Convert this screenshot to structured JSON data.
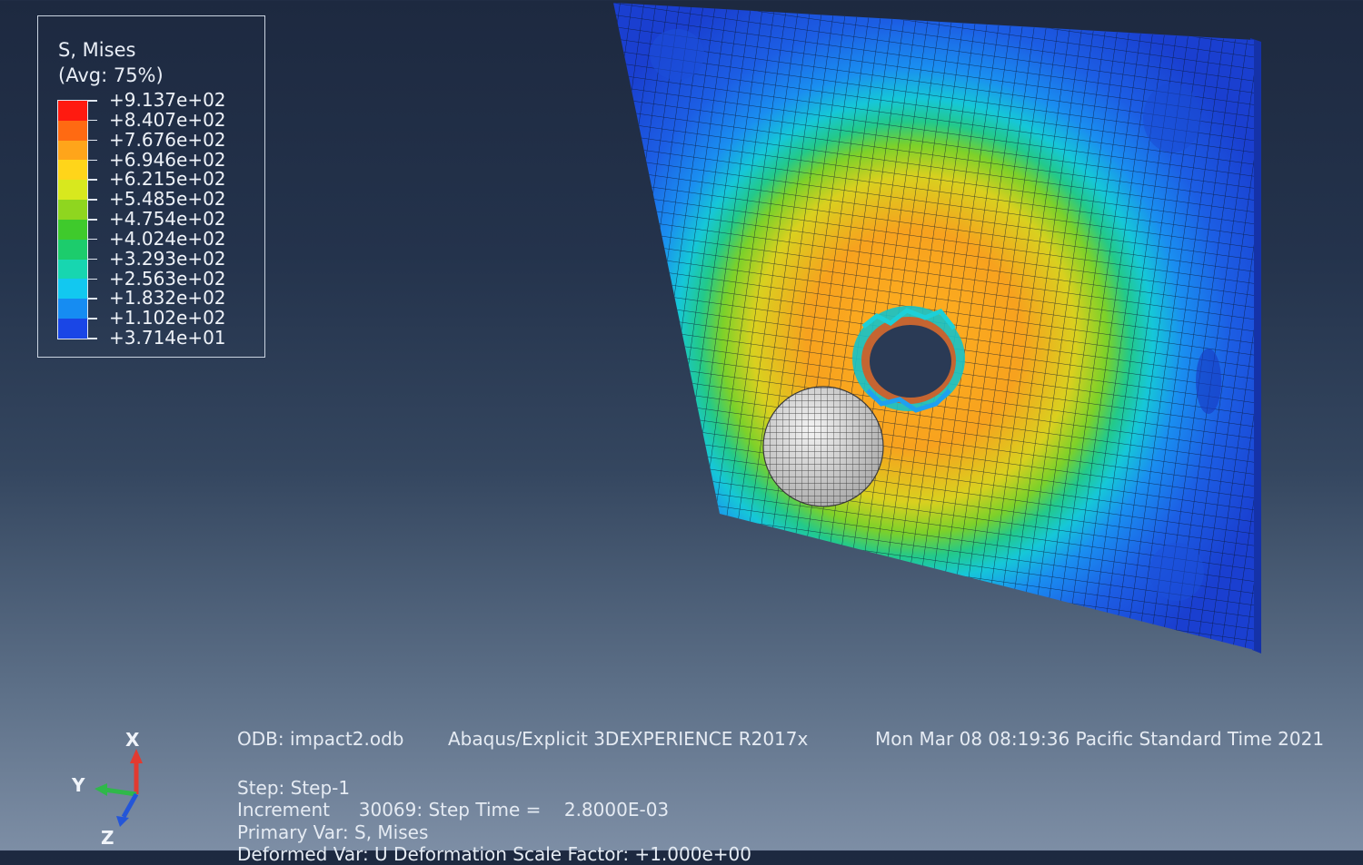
{
  "legend": {
    "title": "S, Mises",
    "subtitle": "(Avg: 75%)",
    "levels": [
      {
        "label": "+9.137e+02",
        "color": "#ff1a10"
      },
      {
        "label": "+8.407e+02",
        "color": "#ff6a12"
      },
      {
        "label": "+7.676e+02",
        "color": "#ffa51a"
      },
      {
        "label": "+6.946e+02",
        "color": "#ffd51a"
      },
      {
        "label": "+6.215e+02",
        "color": "#d8e81e"
      },
      {
        "label": "+5.485e+02",
        "color": "#8fd61f"
      },
      {
        "label": "+4.754e+02",
        "color": "#3fca2c"
      },
      {
        "label": "+4.024e+02",
        "color": "#1ccc6c"
      },
      {
        "label": "+3.293e+02",
        "color": "#17d6b0"
      },
      {
        "label": "+2.563e+02",
        "color": "#12c8f0"
      },
      {
        "label": "+1.832e+02",
        "color": "#168cf2"
      },
      {
        "label": "+1.102e+02",
        "color": "#1a46e6"
      },
      {
        "label": "+3.714e+01",
        "color": "#1a22cc"
      }
    ]
  },
  "info": {
    "odb": "ODB: impact2.odb",
    "solver": "Abaqus/Explicit 3DEXPERIENCE R2017x",
    "timestamp": "Mon Mar 08 08:19:36 Pacific Standard Time 2021",
    "step": "Step: Step-1",
    "increment": "Increment     30069: Step Time =    2.8000E-03",
    "primary_var": "Primary Var: S, Mises",
    "deformed_var": "Deformed Var: U   Deformation Scale Factor: +1.000e+00"
  },
  "triad": {
    "x": "X",
    "y": "Y",
    "z": "Z"
  },
  "colors": {
    "plate_low": "#1a3fd8",
    "plate_mid": "#2fc95a",
    "plate_high": "#f5a623",
    "projectile": "#d9d9d9"
  }
}
